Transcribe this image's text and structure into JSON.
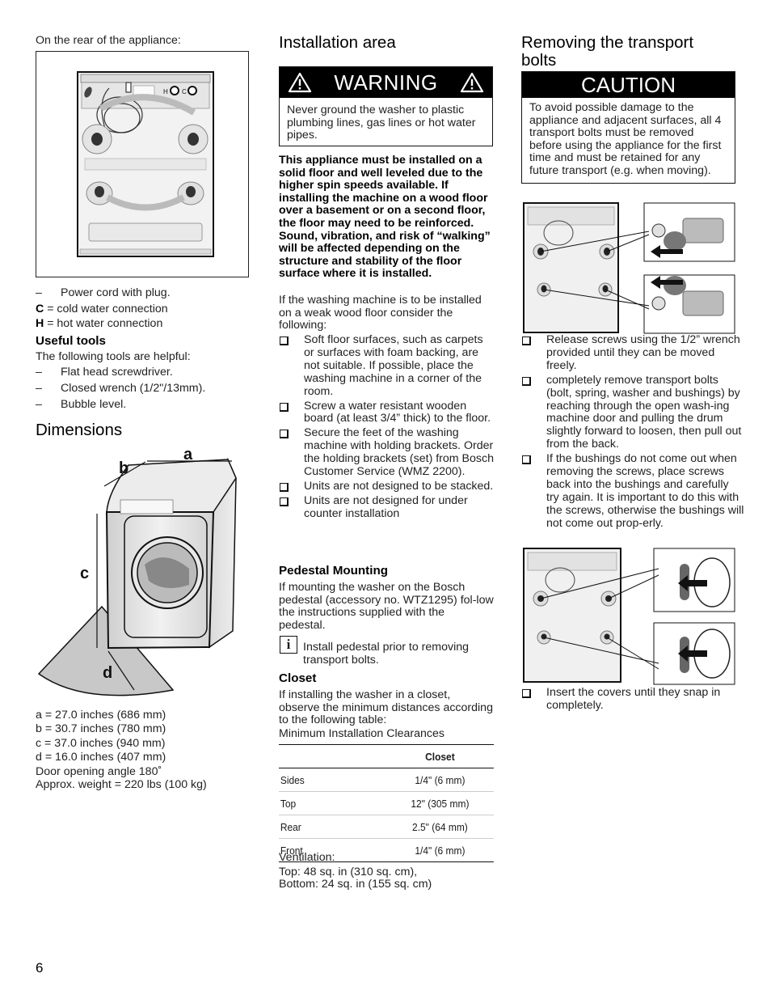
{
  "page_number": "6",
  "column1": {
    "rear_caption": "On the rear of the appliance:",
    "rear_figure": {
      "labels": {
        "hot": "H",
        "cold": "C"
      },
      "icon": "washer-rear-view"
    },
    "rear_list": [
      {
        "marker": "–",
        "text": "Power cord with plug."
      }
    ],
    "connections": [
      {
        "key": "C",
        "text": " = cold water connection"
      },
      {
        "key": "H",
        "text": " = hot water connection"
      }
    ],
    "useful_tools": {
      "heading": "Useful tools",
      "intro": "The following tools are helpful:",
      "items": [
        {
          "marker": "–",
          "text": "Flat head screwdriver."
        },
        {
          "marker": "–",
          "text": "Closed wrench (1/2\"/13mm)."
        },
        {
          "marker": "–",
          "text": "Bubble level."
        }
      ]
    },
    "dimensions": {
      "heading": "Dimensions",
      "figure_labels": {
        "a": "a",
        "b": "b",
        "c": "c",
        "d": "d"
      },
      "specs": [
        "a = 27.0 inches (686 mm)",
        "b = 30.7 inches (780 mm)",
        "c = 37.0 inches (940 mm)",
        "d = 16.0 inches (407 mm)",
        "Door opening angle 180˚",
        "Approx. weight = 220 lbs (100 kg)"
      ]
    }
  },
  "column2": {
    "heading": "Installation area",
    "warning": {
      "title": "WARNING",
      "icon": "warning-triangle",
      "text": "Never ground the washer to plastic plumbing lines, gas lines or hot water pipes."
    },
    "bold_paragraph": "This appliance must be installed on a solid floor and well leveled due to the higher spin speeds available. If installing the machine on a wood floor over a basement or on a second floor, the floor may need to be reinforced. Sound, vibration, and risk of “walking” will be affected depending on the structure and stability of the floor surface where it is installed.",
    "weak_floor_intro": "If the washing machine is to be installed on a weak wood floor consider the following:",
    "weak_floor_items": [
      "Soft floor surfaces, such as carpets or surfaces with foam backing, are not suitable. If possible, place the washing machine in a corner of the room.",
      "Screw a water resistant wooden board (at least 3/4” thick) to the floor.",
      "Secure the feet of the washing machine with holding brackets. Order the holding brackets (set) from Bosch Customer Service (WMZ 2200).",
      "Units are not designed to be stacked.",
      "Units are not designed for under counter installation"
    ],
    "pedestal": {
      "heading": "Pedestal Mounting",
      "text": "If mounting the washer on the Bosch pedestal (accessory no. WTZ1295) fol-low the instructions supplied with the pedestal.",
      "info_icon": "i",
      "info_text": "Install pedestal prior to removing transport bolts."
    },
    "closet": {
      "heading": "Closet",
      "text": "If installing the washer in a closet, observe the minimum distances according to the following table:",
      "table_caption": "Minimum Installation Clearances",
      "table": {
        "headers": [
          "",
          "Closet"
        ],
        "rows": [
          [
            "Sides",
            "1/4\" (6 mm)"
          ],
          [
            "Top",
            "12\" (305 mm)"
          ],
          [
            "Rear",
            "2.5\" (64 mm)"
          ],
          [
            "Front",
            "1/4\" (6 mm)"
          ]
        ]
      },
      "ventilation_label": "Ventilation:",
      "ventilation_top": "Top: 48 sq. in (310 sq. cm),",
      "ventilation_bottom": "Bottom: 24 sq. in (155 sq. cm)"
    }
  },
  "column3": {
    "heading_line1": "Removing the transport",
    "heading_line2": "bolts",
    "caution": {
      "title": "CAUTION",
      "text": "To avoid possible damage to the appliance and adjacent surfaces, all 4 transport bolts must be removed before using the appliance for the first time and must be retained for any future transport (e.g. when moving)."
    },
    "steps": [
      "Release screws using the 1/2” wrench provided until they can be moved freely.",
      "completely remove transport bolts (bolt, spring, washer and bushings) by reaching through the open wash-ing machine door and pulling the drum slightly forward to loosen, then pull out from the back.",
      "If the bushings do not come out when removing the screws, place screws back into the bushings and carefully try again.  It is important to do this with the screws, otherwise the bushings will not come out prop-erly."
    ],
    "final_step": "Insert the covers until they snap in completely."
  }
}
